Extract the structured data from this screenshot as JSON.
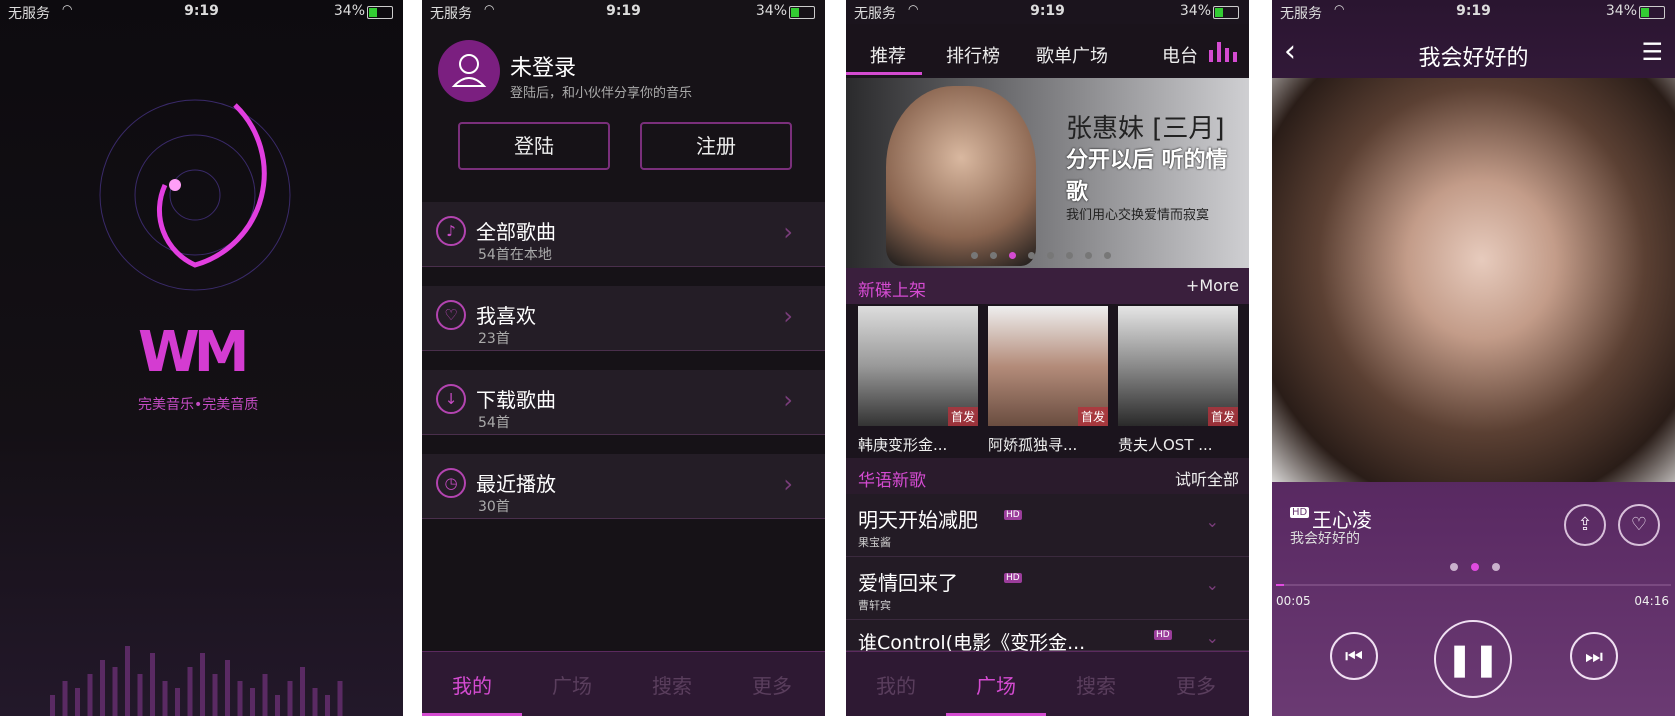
{
  "status": {
    "carrier": "无服务",
    "time": "9:19",
    "battery": "34%"
  },
  "splash": {
    "logo": "WM",
    "tagline": "完美音乐•完美音质",
    "equalizer": [
      3,
      5,
      4,
      6,
      8,
      7,
      10,
      6,
      9,
      5,
      4,
      7,
      9,
      6,
      8,
      5,
      4,
      6,
      3,
      5,
      7,
      4,
      3,
      5
    ]
  },
  "mine": {
    "title": "未登录",
    "subtitle": "登陆后，和小伙伴分享你的音乐",
    "login": "登陆",
    "register": "注册",
    "items": [
      {
        "label": "全部歌曲",
        "sub": "54首在本地",
        "icon": "♪"
      },
      {
        "label": "我喜欢",
        "sub": "23首",
        "icon": "♡"
      },
      {
        "label": "下载歌曲",
        "sub": "54首",
        "icon": "↓"
      },
      {
        "label": "最近播放",
        "sub": "30首",
        "icon": "◷"
      }
    ]
  },
  "tabs": [
    "我的",
    "广场",
    "搜索",
    "更多"
  ],
  "plaza": {
    "nav": [
      "推荐",
      "排行榜",
      "歌单广场",
      "电台"
    ],
    "banner": {
      "line1": "张惠妹 [三月]",
      "line2": "分开以后 听的情歌",
      "line3": "我们用心交换爱情而寂寞"
    },
    "new_title": "新碟上架",
    "more": "+More",
    "albums": [
      {
        "title": "韩庚变形金...",
        "badge": "首发"
      },
      {
        "title": "阿娇孤独寻...",
        "badge": "首发"
      },
      {
        "title": "贵夫人OST ...",
        "badge": "首发"
      }
    ],
    "chinese_title": "华语新歌",
    "listen_all": "试听全部",
    "songs": [
      {
        "name": "明天开始减肥",
        "artist": "果宝酱"
      },
      {
        "name": "爱情回来了",
        "artist": "曹轩宾"
      },
      {
        "name": "谁Control(电影《变形金...",
        "artist": ""
      }
    ],
    "hd": "HD"
  },
  "player": {
    "title": "我会好好的",
    "artist": "王心凌",
    "song": "我会好好的",
    "elapsed": "00:05",
    "duration": "04:16",
    "progress": 0.02
  }
}
